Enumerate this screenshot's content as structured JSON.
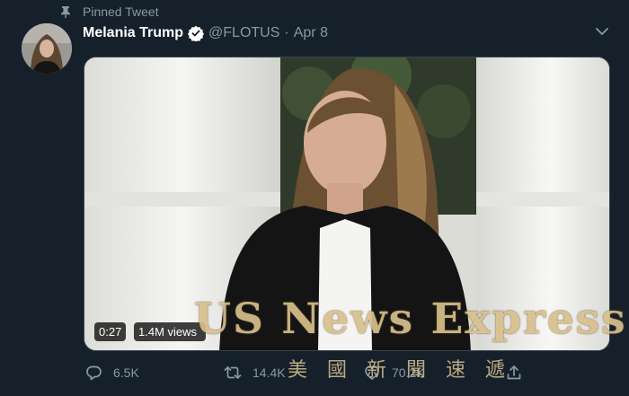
{
  "pinned": {
    "label": "Pinned Tweet",
    "icon": "pin-icon"
  },
  "tweet": {
    "display_name": "Melania Trump",
    "handle": "@FLOTUS",
    "separator": "·",
    "date": "Apr 8",
    "verified": true
  },
  "video": {
    "duration": "0:27",
    "views": "1.4M views"
  },
  "actions": {
    "reply_count": "6.5K",
    "retweet_count": "14.4K",
    "like_count": "70.2K"
  },
  "watermark": {
    "text": "US News Express",
    "chinese": "美國新聞速遞"
  },
  "colors": {
    "background": "#15202b",
    "secondary_text": "#8899a6",
    "verified_badge": "#ffffff",
    "watermark": "#d9c08c"
  }
}
